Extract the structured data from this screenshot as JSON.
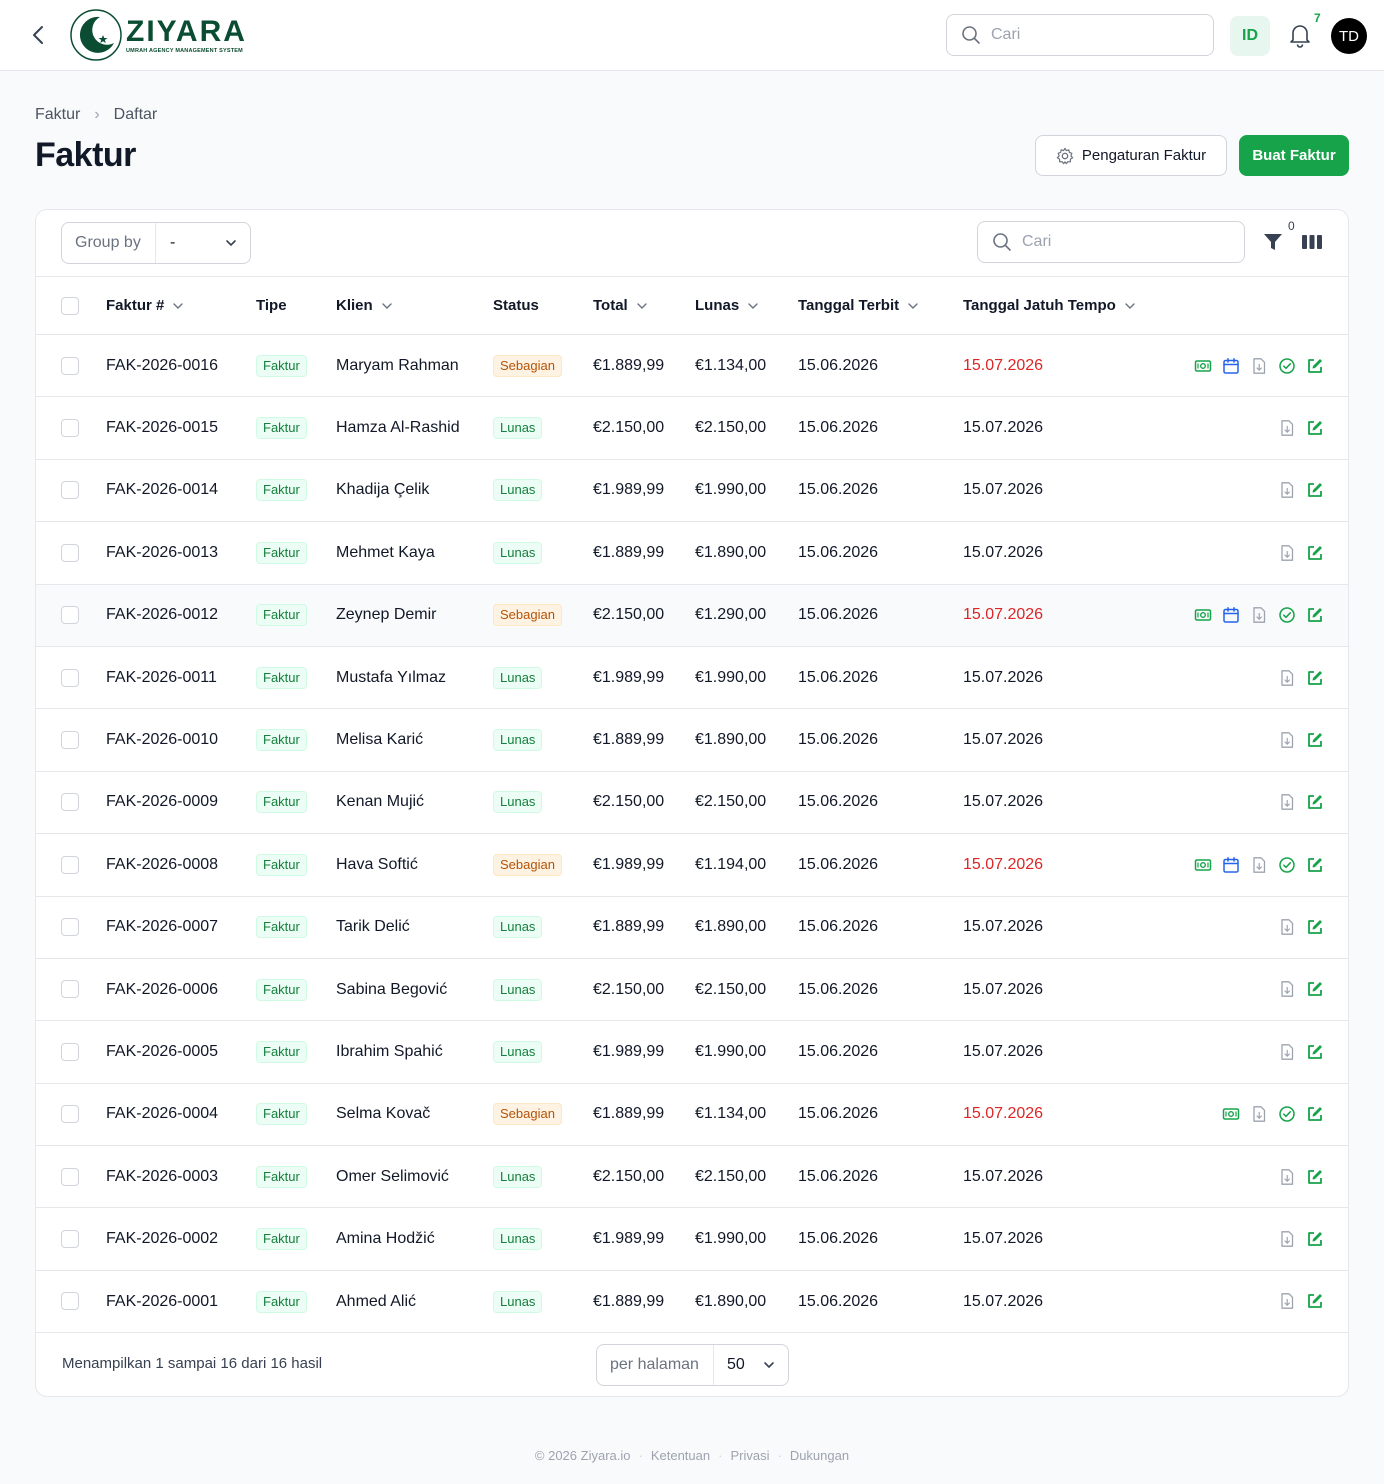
{
  "header": {
    "logo_title": "ZIYARA",
    "logo_subtitle": "UMRAH AGENCY MANAGEMENT SYSTEM",
    "search_placeholder": "Cari",
    "language": "ID",
    "notifications_count": "7",
    "avatar_initials": "TD"
  },
  "breadcrumb": [
    "Faktur",
    "Daftar"
  ],
  "page_title": "Faktur",
  "actions": {
    "settings_label": "Pengaturan Faktur",
    "create_label": "Buat Faktur"
  },
  "toolbar": {
    "group_by_label": "Group by",
    "group_by_value": "-",
    "search_placeholder": "Cari",
    "filter_count": "0"
  },
  "table": {
    "columns": [
      "Faktur #",
      "Tipe",
      "Klien",
      "Status",
      "Total",
      "Lunas",
      "Tanggal Terbit",
      "Tanggal Jatuh Tempo"
    ],
    "rows": [
      {
        "no": "FAK-2026-0016",
        "tipe": "Faktur",
        "klien": "Maryam Rahman",
        "status": "Sebagian",
        "total": "€1.889,99",
        "lunas": "€1.134,00",
        "terbit": "15.06.2026",
        "tempo": "15.07.2026",
        "overdue": true,
        "actions": [
          "payment",
          "schedule",
          "pdf",
          "mark-paid",
          "edit"
        ]
      },
      {
        "no": "FAK-2026-0015",
        "tipe": "Faktur",
        "klien": "Hamza Al-Rashid",
        "status": "Lunas",
        "total": "€2.150,00",
        "lunas": "€2.150,00",
        "terbit": "15.06.2026",
        "tempo": "15.07.2026",
        "overdue": false,
        "actions": [
          "pdf",
          "edit"
        ]
      },
      {
        "no": "FAK-2026-0014",
        "tipe": "Faktur",
        "klien": "Khadija Çelik",
        "status": "Lunas",
        "total": "€1.989,99",
        "lunas": "€1.990,00",
        "terbit": "15.06.2026",
        "tempo": "15.07.2026",
        "overdue": false,
        "actions": [
          "pdf",
          "edit"
        ]
      },
      {
        "no": "FAK-2026-0013",
        "tipe": "Faktur",
        "klien": "Mehmet Kaya",
        "status": "Lunas",
        "total": "€1.889,99",
        "lunas": "€1.890,00",
        "terbit": "15.06.2026",
        "tempo": "15.07.2026",
        "overdue": false,
        "actions": [
          "pdf",
          "edit"
        ]
      },
      {
        "no": "FAK-2026-0012",
        "tipe": "Faktur",
        "klien": "Zeynep Demir",
        "status": "Sebagian",
        "total": "€2.150,00",
        "lunas": "€1.290,00",
        "terbit": "15.06.2026",
        "tempo": "15.07.2026",
        "overdue": true,
        "highlight": true,
        "actions": [
          "payment",
          "schedule",
          "pdf",
          "mark-paid",
          "edit"
        ]
      },
      {
        "no": "FAK-2026-0011",
        "tipe": "Faktur",
        "klien": "Mustafa Yılmaz",
        "status": "Lunas",
        "total": "€1.989,99",
        "lunas": "€1.990,00",
        "terbit": "15.06.2026",
        "tempo": "15.07.2026",
        "overdue": false,
        "actions": [
          "pdf",
          "edit"
        ]
      },
      {
        "no": "FAK-2026-0010",
        "tipe": "Faktur",
        "klien": "Melisa Karić",
        "status": "Lunas",
        "total": "€1.889,99",
        "lunas": "€1.890,00",
        "terbit": "15.06.2026",
        "tempo": "15.07.2026",
        "overdue": false,
        "actions": [
          "pdf",
          "edit"
        ]
      },
      {
        "no": "FAK-2026-0009",
        "tipe": "Faktur",
        "klien": "Kenan Mujić",
        "status": "Lunas",
        "total": "€2.150,00",
        "lunas": "€2.150,00",
        "terbit": "15.06.2026",
        "tempo": "15.07.2026",
        "overdue": false,
        "actions": [
          "pdf",
          "edit"
        ]
      },
      {
        "no": "FAK-2026-0008",
        "tipe": "Faktur",
        "klien": "Hava Softić",
        "status": "Sebagian",
        "total": "€1.989,99",
        "lunas": "€1.194,00",
        "terbit": "15.06.2026",
        "tempo": "15.07.2026",
        "overdue": true,
        "actions": [
          "payment",
          "schedule",
          "pdf",
          "mark-paid",
          "edit"
        ]
      },
      {
        "no": "FAK-2026-0007",
        "tipe": "Faktur",
        "klien": "Tarik Delić",
        "status": "Lunas",
        "total": "€1.889,99",
        "lunas": "€1.890,00",
        "terbit": "15.06.2026",
        "tempo": "15.07.2026",
        "overdue": false,
        "actions": [
          "pdf",
          "edit"
        ]
      },
      {
        "no": "FAK-2026-0006",
        "tipe": "Faktur",
        "klien": "Sabina Begović",
        "status": "Lunas",
        "total": "€2.150,00",
        "lunas": "€2.150,00",
        "terbit": "15.06.2026",
        "tempo": "15.07.2026",
        "overdue": false,
        "actions": [
          "pdf",
          "edit"
        ]
      },
      {
        "no": "FAK-2026-0005",
        "tipe": "Faktur",
        "klien": "Ibrahim Spahić",
        "status": "Lunas",
        "total": "€1.989,99",
        "lunas": "€1.990,00",
        "terbit": "15.06.2026",
        "tempo": "15.07.2026",
        "overdue": false,
        "actions": [
          "pdf",
          "edit"
        ]
      },
      {
        "no": "FAK-2026-0004",
        "tipe": "Faktur",
        "klien": "Selma Kovač",
        "status": "Sebagian",
        "total": "€1.889,99",
        "lunas": "€1.134,00",
        "terbit": "15.06.2026",
        "tempo": "15.07.2026",
        "overdue": true,
        "actions": [
          "payment",
          "pdf",
          "mark-paid",
          "edit"
        ]
      },
      {
        "no": "FAK-2026-0003",
        "tipe": "Faktur",
        "klien": "Omer Selimović",
        "status": "Lunas",
        "total": "€2.150,00",
        "lunas": "€2.150,00",
        "terbit": "15.06.2026",
        "tempo": "15.07.2026",
        "overdue": false,
        "actions": [
          "pdf",
          "edit"
        ]
      },
      {
        "no": "FAK-2026-0002",
        "tipe": "Faktur",
        "klien": "Amina Hodžić",
        "status": "Lunas",
        "total": "€1.989,99",
        "lunas": "€1.990,00",
        "terbit": "15.06.2026",
        "tempo": "15.07.2026",
        "overdue": false,
        "actions": [
          "pdf",
          "edit"
        ]
      },
      {
        "no": "FAK-2026-0001",
        "tipe": "Faktur",
        "klien": "Ahmed Alić",
        "status": "Lunas",
        "total": "€1.889,99",
        "lunas": "€1.890,00",
        "terbit": "15.06.2026",
        "tempo": "15.07.2026",
        "overdue": false,
        "actions": [
          "pdf",
          "edit"
        ]
      }
    ]
  },
  "pagination": {
    "showing_text": "Menampilkan 1 sampai 16 dari 16 hasil",
    "per_page_label": "per halaman",
    "per_page_value": "50"
  },
  "footer": {
    "copyright": "© 2026 Ziyara.io",
    "links": [
      "Ketentuan",
      "Privasi",
      "Dukungan"
    ]
  },
  "colors": {
    "accent": "#16a34a",
    "brand_dark": "#0b4d32",
    "overdue": "#dc2626",
    "partial_badge": "#b45309",
    "schedule_icon": "#2563eb"
  }
}
